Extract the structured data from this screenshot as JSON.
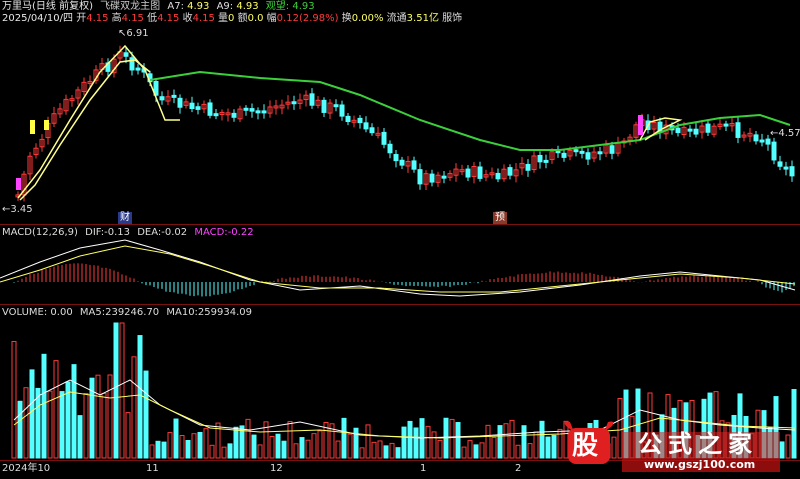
{
  "header": {
    "app_title": "万里马(日线 前复权)",
    "indicator_name": "飞碟双龙主图",
    "a7_label": "A7:",
    "a7_value": "4.93",
    "a9_label": "A9:",
    "a9_value": "4.93",
    "watch_label": "观望:",
    "watch_value": "4.93"
  },
  "info_bar": {
    "date": "2025/04/10/四",
    "open_label": "开",
    "open": "4.15",
    "high_label": "高",
    "high": "4.15",
    "low_label": "低",
    "low": "4.15",
    "close_label": "收",
    "close": "4.15",
    "vol_label": "量",
    "vol": "0",
    "amount_label": "额",
    "amount": "0.0",
    "change_label": "幅",
    "change": "0.12(2.98%)",
    "turnover_label": "换",
    "turnover": "0.00%",
    "float_label": "流通",
    "float_cap": "3.51亿",
    "industry": "服饰"
  },
  "price_panel": {
    "high_marker": "6.91",
    "right_price": "4.57",
    "low_marker": "3.45",
    "event_cai": "财",
    "event_yu": "预"
  },
  "macd_panel": {
    "title": "MACD(12,26,9)",
    "dif_label": "DIF:",
    "dif": "-0.13",
    "dea_label": "DEA:",
    "dea": "-0.02",
    "macd_label": "MACD:",
    "macd": "-0.22"
  },
  "volume_panel": {
    "title": "VOLUME: 0.00",
    "ma5_label": "MA5:",
    "ma5": "239246.70",
    "ma10_label": "MA10:",
    "ma10": "259934.09"
  },
  "time_axis": {
    "labels": [
      "2024年10",
      "11",
      "12",
      "1",
      "2"
    ]
  },
  "watermark": {
    "logo_char": "股",
    "brand": "公式之家",
    "url": "www.gszj100.com"
  },
  "colors": {
    "up": "#ff3b3b",
    "down": "#54ffff",
    "ma_green": "#3ccf3c",
    "ma_yellow": "#ffff8a",
    "separator": "#7a1010",
    "macd_purple": "#ff44ff"
  }
}
